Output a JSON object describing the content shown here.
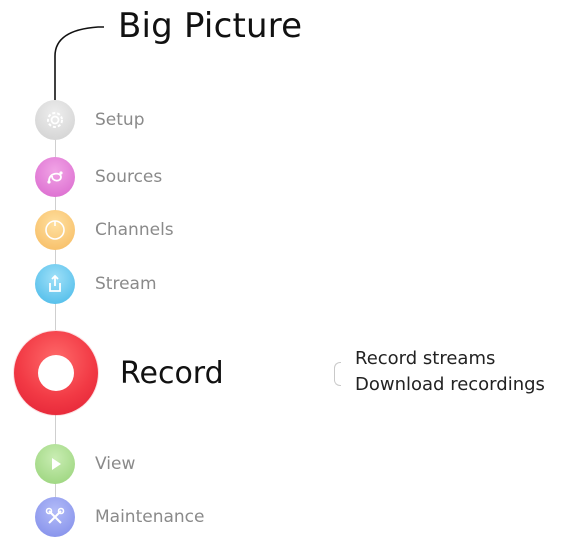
{
  "title": "Big Picture",
  "steps": [
    {
      "label": "Setup",
      "icon": "gear-icon",
      "color": "#d6d6d6"
    },
    {
      "label": "Sources",
      "icon": "link-icon",
      "color": "#e07ad0"
    },
    {
      "label": "Channels",
      "icon": "dial-icon",
      "color": "#f9c66e"
    },
    {
      "label": "Stream",
      "icon": "upload-icon",
      "color": "#5cc6ef"
    },
    {
      "label": "View",
      "icon": "play-icon",
      "color": "#a6dc86"
    },
    {
      "label": "Maintenance",
      "icon": "tools-icon",
      "color": "#8a96ee"
    }
  ],
  "record": {
    "label": "Record",
    "color": "#ef2b3f",
    "actions": [
      "Record streams",
      "Download recordings"
    ]
  }
}
